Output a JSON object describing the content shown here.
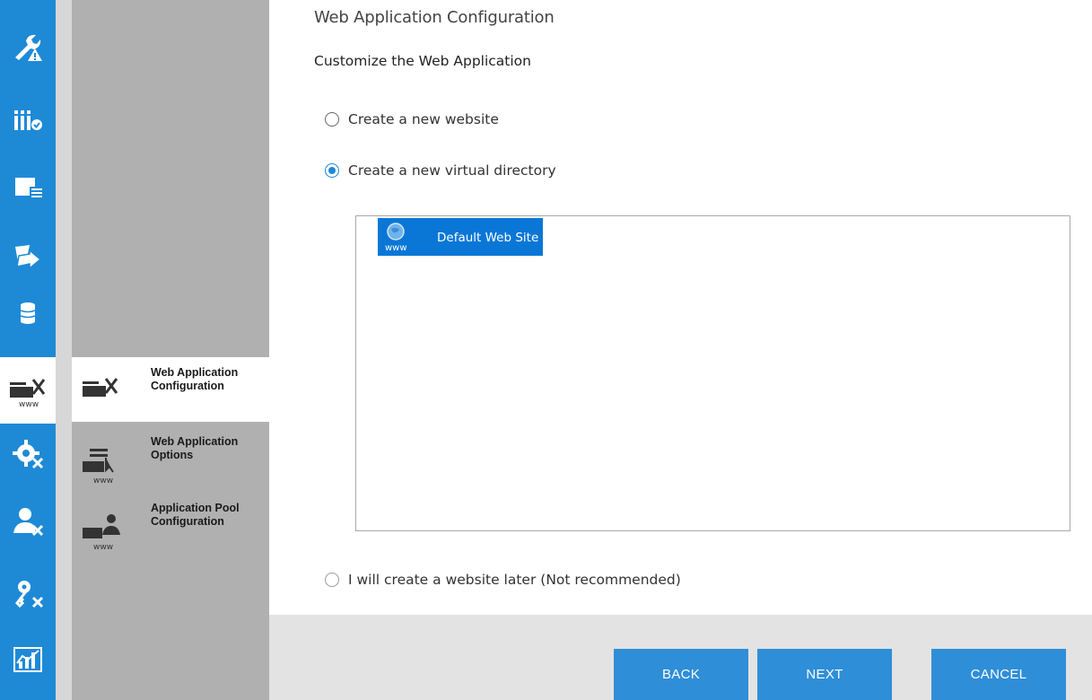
{
  "wizard": {
    "page_title": "Web Application Configuration",
    "section_title": "Customize the Web Application"
  },
  "nav_rail": {
    "items": [
      {
        "icon": "wrench-warning-icon",
        "active": false
      },
      {
        "icon": "iis-check-icon",
        "active": false
      },
      {
        "icon": "window-list-icon",
        "active": false
      },
      {
        "icon": "migrate-arrow-icon",
        "active": false
      },
      {
        "icon": "database-icon",
        "active": false
      },
      {
        "icon": "web-tools-www-icon",
        "active": true
      },
      {
        "icon": "gear-tools-icon",
        "active": false
      },
      {
        "icon": "user-tools-icon",
        "active": false
      },
      {
        "icon": "key-tools-icon",
        "active": false
      },
      {
        "icon": "chart-icon",
        "active": false
      }
    ]
  },
  "steps": [
    {
      "label": "Web Application Configuration",
      "icon": "web-tools-icon",
      "active": true
    },
    {
      "label": "Web Application Options",
      "icon": "web-options-www-icon",
      "active": false
    },
    {
      "label": "Application Pool Configuration",
      "icon": "app-pool-www-icon",
      "active": false
    }
  ],
  "options": {
    "new_website": {
      "label": "Create a new website",
      "checked": false
    },
    "new_virtual_directory": {
      "label": "Create a new virtual directory",
      "checked": true
    },
    "later": {
      "label": "I will create a website later (Not recommended)",
      "checked": false
    }
  },
  "site_tree": {
    "items": [
      {
        "label": "Default Web Site",
        "icon_text": "www",
        "selected": true
      }
    ]
  },
  "buttons": {
    "back": "BACK",
    "next": "NEXT",
    "cancel": "CANCEL"
  },
  "colors": {
    "accent": "#1e8ad6",
    "selection": "#0a77d6",
    "button": "#2f8ed8",
    "sidebar": "#b0b0b0",
    "footer": "#e3e3e3"
  }
}
